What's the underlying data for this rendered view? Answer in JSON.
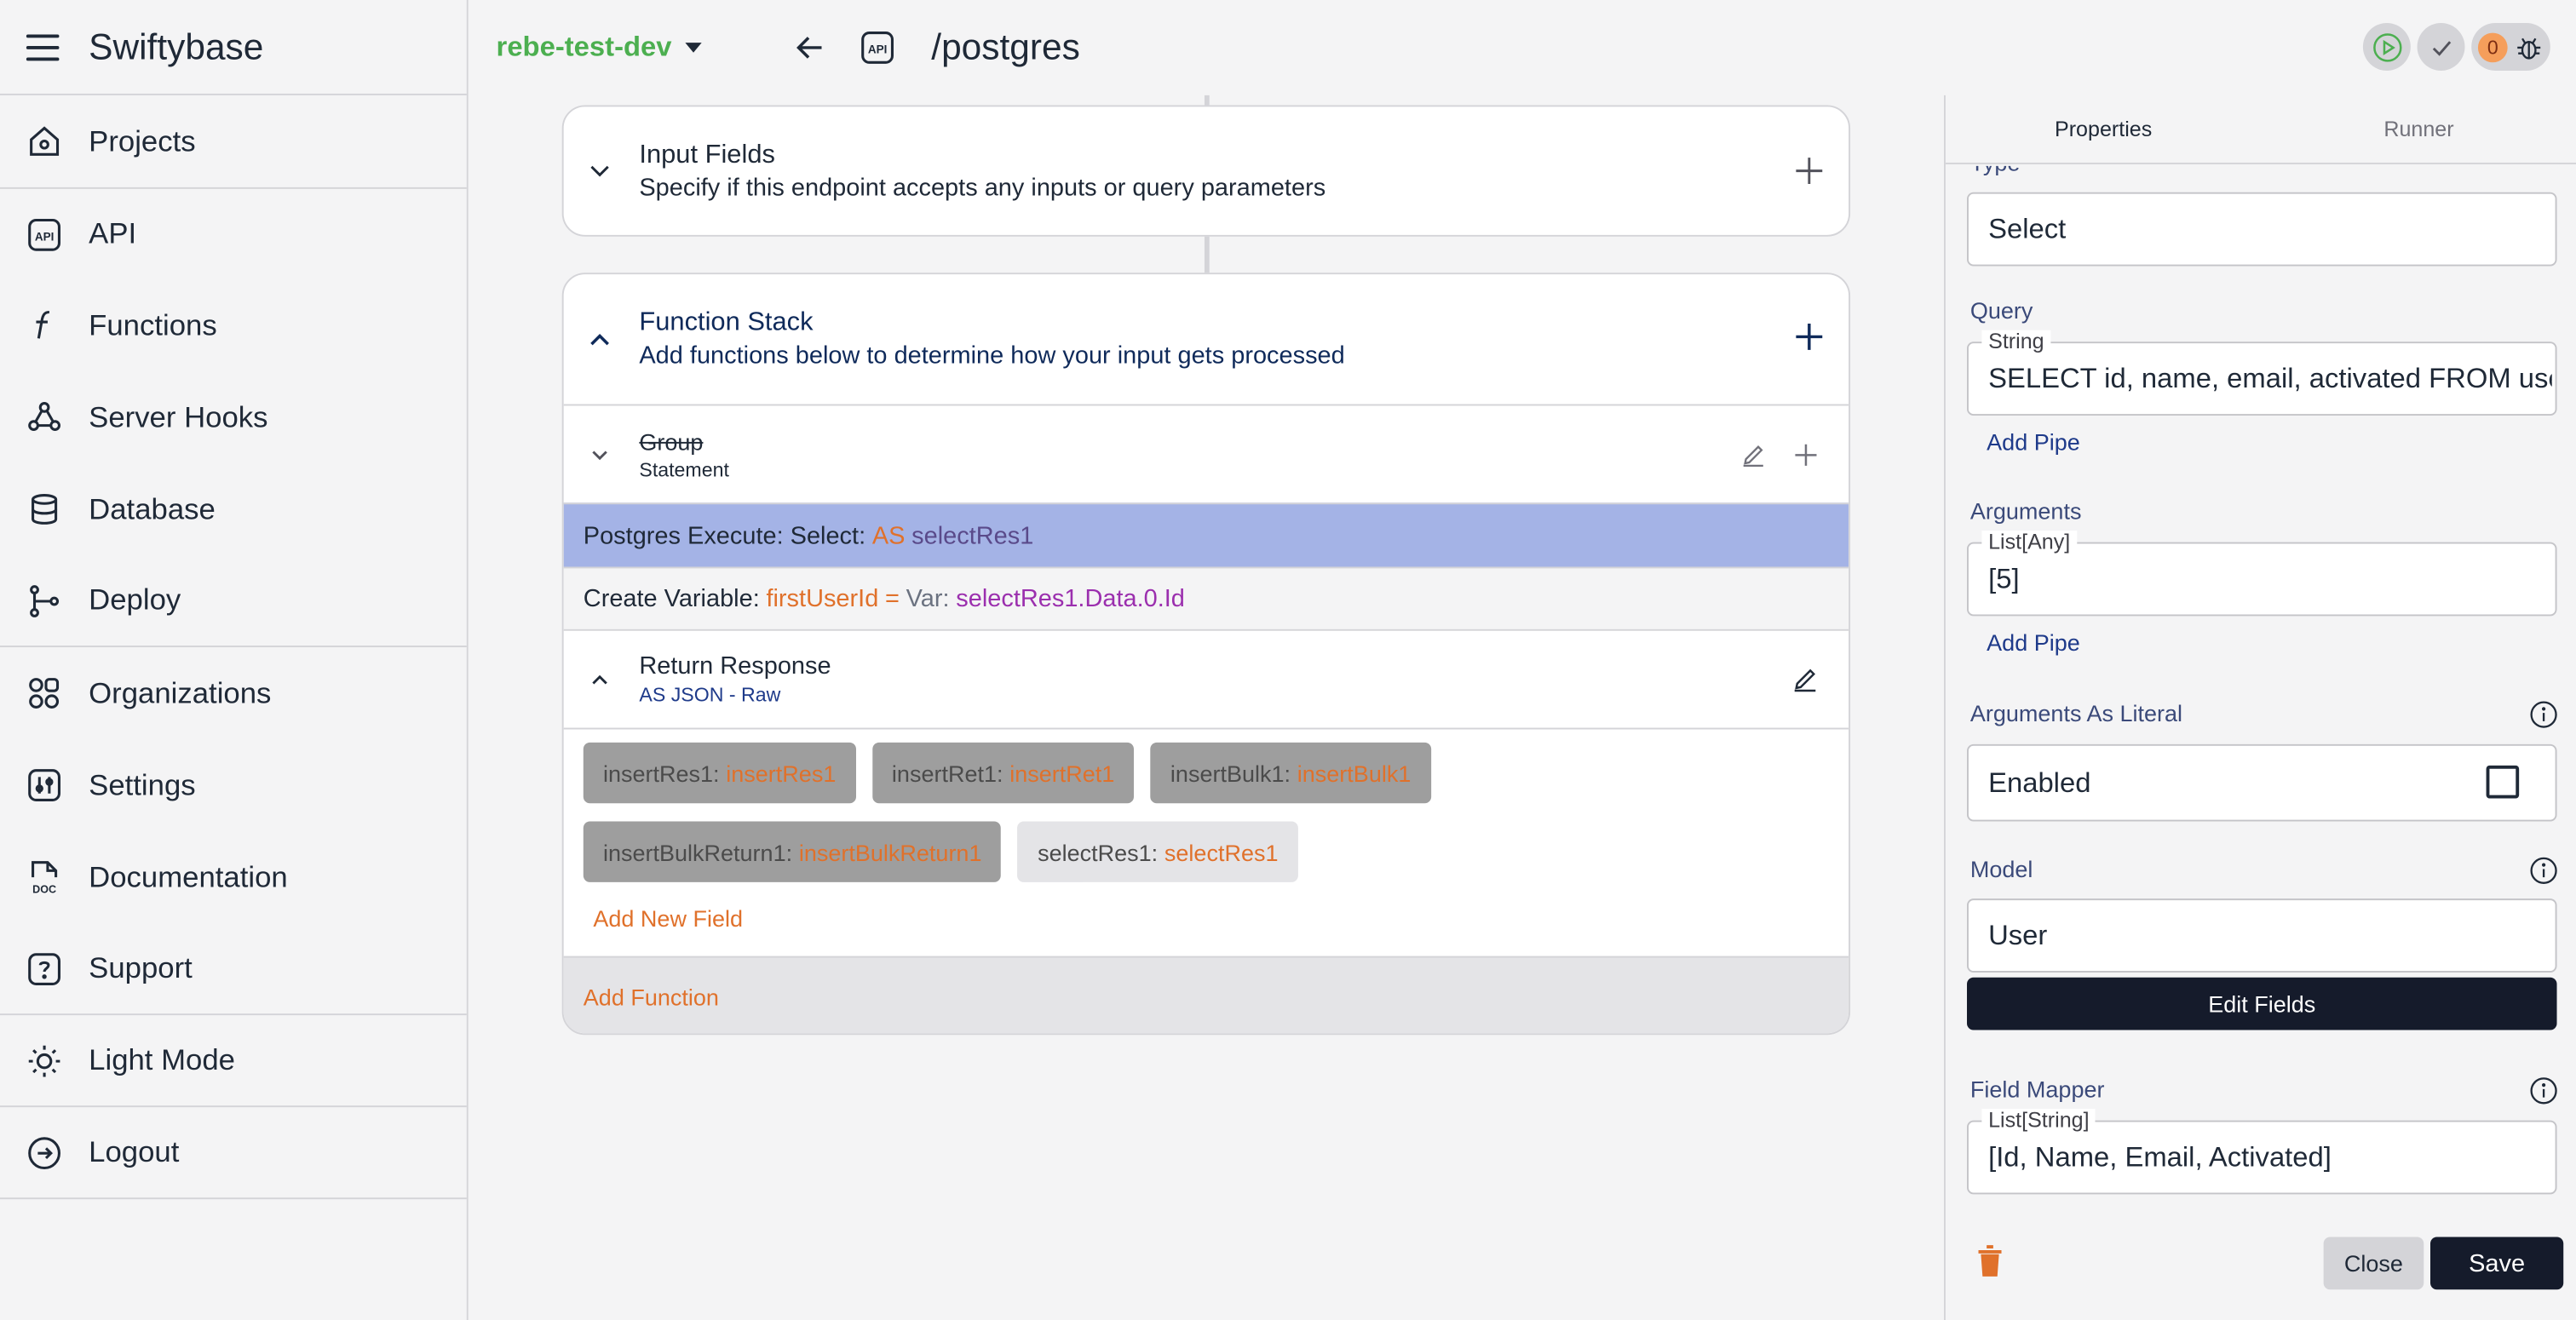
{
  "app": {
    "name": "Swiftybase"
  },
  "sidebar": {
    "items": [
      {
        "label": "Projects",
        "icon": "home-icon"
      },
      {
        "label": "API",
        "icon": "api-icon"
      },
      {
        "label": "Functions",
        "icon": "function-icon"
      },
      {
        "label": "Server Hooks",
        "icon": "webhook-icon"
      },
      {
        "label": "Database",
        "icon": "database-icon"
      },
      {
        "label": "Deploy",
        "icon": "git-branch-icon"
      },
      {
        "label": "Organizations",
        "icon": "organizations-icon"
      },
      {
        "label": "Settings",
        "icon": "settings-icon"
      },
      {
        "label": "Documentation",
        "icon": "doc-icon"
      },
      {
        "label": "Support",
        "icon": "help-icon"
      },
      {
        "label": "Light Mode",
        "icon": "sun-icon"
      },
      {
        "label": "Logout",
        "icon": "logout-icon"
      }
    ]
  },
  "topbar": {
    "branch": "rebe-test-dev",
    "path": "/postgres",
    "api_badge": "API",
    "issue_count": "0"
  },
  "input_fields": {
    "title": "Input Fields",
    "subtitle": "Specify if this endpoint accepts any inputs or query parameters"
  },
  "function_stack": {
    "title": "Function Stack",
    "subtitle": "Add functions below to determine how your input gets processed",
    "group": {
      "title": "Group",
      "subtitle": "Statement"
    },
    "postgres_row": {
      "prefix": "Postgres Execute: Select:",
      "as": "AS",
      "var": "selectRes1"
    },
    "create_var_row": {
      "prefix": "Create Variable:",
      "name": "firstUserId",
      "eq": "=",
      "var_label": "Var:",
      "value": "selectRes1.Data.0.Id"
    },
    "return_response": {
      "title": "Return Response",
      "subtitle": "AS JSON - Raw"
    },
    "chips": [
      {
        "key": "insertRes1:",
        "value": "insertRes1"
      },
      {
        "key": "insertRet1:",
        "value": "insertRet1"
      },
      {
        "key": "insertBulk1:",
        "value": "insertBulk1"
      },
      {
        "key": "insertBulkReturn1:",
        "value": "insertBulkReturn1"
      },
      {
        "key": "selectRes1:",
        "value": "selectRes1"
      }
    ],
    "add_new_field": "Add New Field",
    "add_function": "Add Function"
  },
  "panel": {
    "tabs": [
      "Properties",
      "Runner"
    ],
    "type_label": "Type",
    "type_value": "Select",
    "query_label": "Query",
    "query_legend": "String",
    "query_value": "SELECT id, name, email, activated FROM users",
    "add_pipe": "Add Pipe",
    "arguments_label": "Arguments",
    "arguments_legend": "List[Any]",
    "arguments_value": "[5]",
    "args_literal_label": "Arguments As Literal",
    "enabled_label": "Enabled",
    "model_label": "Model",
    "model_value": "User",
    "edit_fields": "Edit Fields",
    "field_mapper_label": "Field Mapper",
    "field_mapper_legend": "List[String]",
    "field_mapper_value": "[Id, Name, Email, Activated]",
    "close": "Close",
    "save": "Save"
  },
  "colors": {
    "branch": "#4caf50",
    "accent_orange": "#e0712b",
    "var_purple": "#9b2fae",
    "selected_row": "#a4b3e6",
    "dark_button": "#151b2b"
  }
}
